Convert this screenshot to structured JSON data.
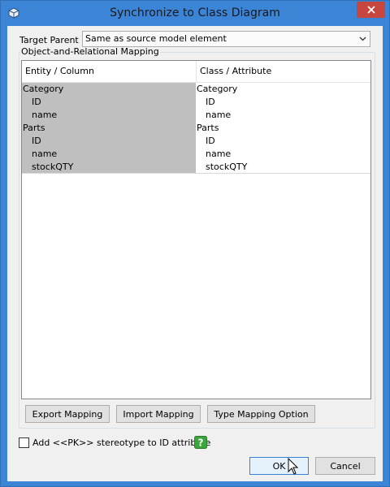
{
  "window": {
    "title": "Synchronize to Class Diagram"
  },
  "target_parent": {
    "label": "Target Parent :",
    "value": "Same as source model element"
  },
  "mapping": {
    "group_label": "Object-and-Relational Mapping",
    "columns": [
      "Entity / Column",
      "Class / Attribute"
    ],
    "rows": [
      {
        "type": "group",
        "entity": "Category",
        "class": "Category"
      },
      {
        "type": "child",
        "entity": "ID",
        "class": "ID"
      },
      {
        "type": "child",
        "entity": "name",
        "class": "name"
      },
      {
        "type": "group",
        "entity": "Parts",
        "class": "Parts"
      },
      {
        "type": "child",
        "entity": "ID",
        "class": "ID"
      },
      {
        "type": "child",
        "entity": "name",
        "class": "name"
      },
      {
        "type": "child",
        "entity": "stockQTY",
        "class": "stockQTY"
      }
    ]
  },
  "buttons": {
    "export": "Export Mapping",
    "import": "Import Mapping",
    "type_option": "Type Mapping Option",
    "ok": "OK",
    "cancel": "Cancel"
  },
  "checkbox": {
    "label": "Add <<PK>> stereotype to ID attribute",
    "checked": false
  },
  "colors": {
    "titlebar": "#3c84d6",
    "close": "#c7463e",
    "entity_cell": "#bfbfbf",
    "help": "#3aa53a"
  },
  "icons": [
    "app-icon",
    "close-icon",
    "chevron-down-icon",
    "help-icon",
    "mouse-cursor-icon"
  ]
}
